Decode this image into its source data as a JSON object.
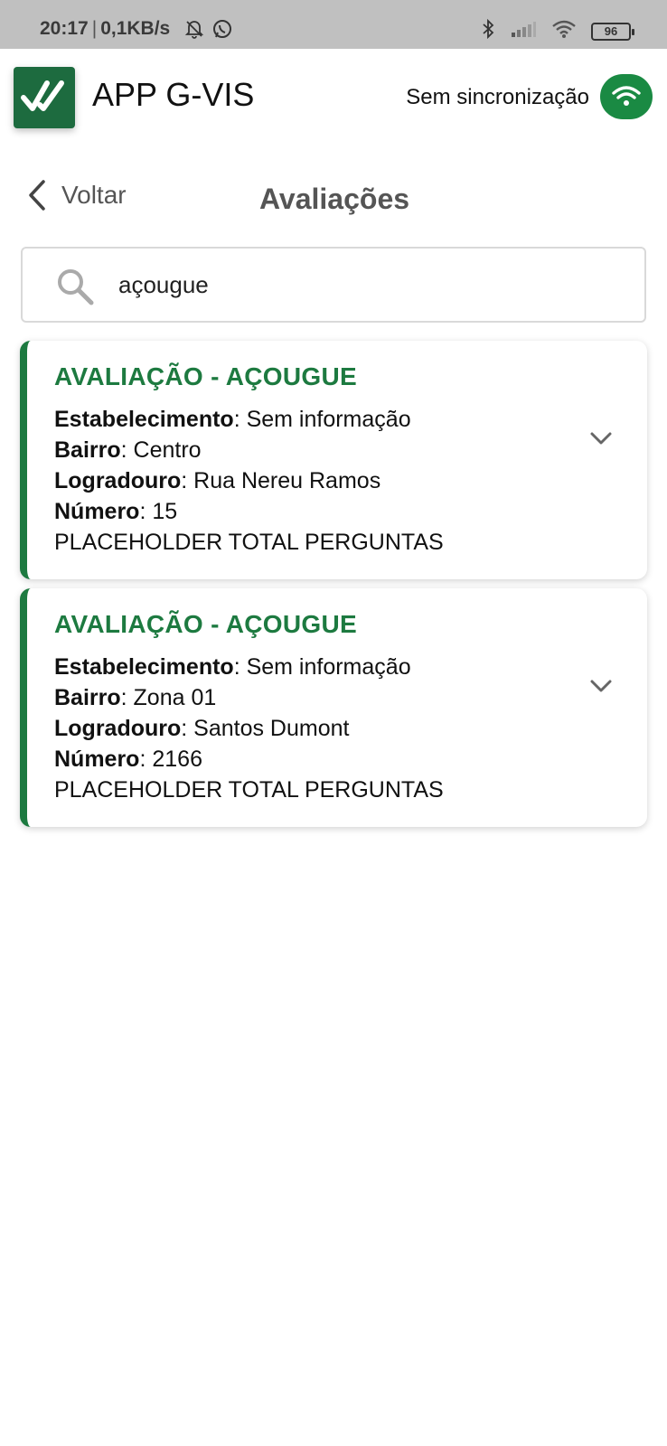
{
  "status_bar": {
    "time": "20:17",
    "speed": "0,1KB/s",
    "battery": "96",
    "icons": [
      "bell-off-icon",
      "whatsapp-icon",
      "bluetooth-icon",
      "signal-icon",
      "wifi-icon",
      "battery-icon"
    ]
  },
  "header": {
    "app_title": "APP G-VIS",
    "sync_label": "Sem sincronização",
    "accent_color": "#1a8a43"
  },
  "nav": {
    "back_label": "Voltar",
    "page_title": "Avaliações"
  },
  "search": {
    "value": "açougue"
  },
  "cards": [
    {
      "title": "AVALIAÇÃO - AÇOUGUE",
      "estabelecimento_label": "Estabelecimento",
      "estabelecimento_value": ": Sem informação",
      "bairro_label": "Bairro",
      "bairro_value": ": Centro",
      "logradouro_label": "Logradouro",
      "logradouro_value": ": Rua Nereu Ramos",
      "numero_label": "Número",
      "numero_value": ": 15",
      "placeholder": "PLACEHOLDER TOTAL PERGUNTAS"
    },
    {
      "title": "AVALIAÇÃO - AÇOUGUE",
      "estabelecimento_label": "Estabelecimento",
      "estabelecimento_value": ": Sem informação",
      "bairro_label": "Bairro",
      "bairro_value": ": Zona 01",
      "logradouro_label": "Logradouro",
      "logradouro_value": ": Santos Dumont",
      "numero_label": "Número",
      "numero_value": ": 2166",
      "placeholder": "PLACEHOLDER TOTAL PERGUNTAS"
    }
  ]
}
